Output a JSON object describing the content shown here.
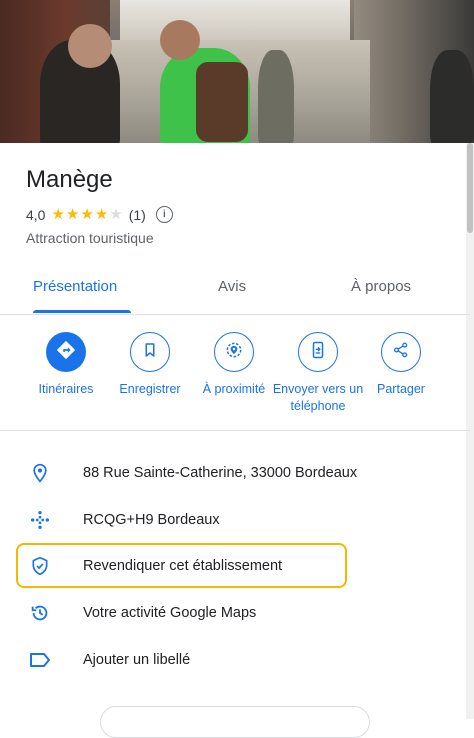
{
  "place": {
    "name": "Manège",
    "rating": "4,0",
    "stars_filled": 4,
    "stars_total": 5,
    "review_count": "(1)",
    "category": "Attraction touristique"
  },
  "tabs": [
    {
      "label": "Présentation",
      "active": true
    },
    {
      "label": "Avis",
      "active": false
    },
    {
      "label": "À propos",
      "active": false
    }
  ],
  "actions": [
    {
      "label": "Itinéraires",
      "icon": "directions-icon"
    },
    {
      "label": "Enregistrer",
      "icon": "bookmark-icon"
    },
    {
      "label": "À proximité",
      "icon": "nearby-icon"
    },
    {
      "label": "Envoyer vers un téléphone",
      "icon": "send-to-phone-icon"
    },
    {
      "label": "Partager",
      "icon": "share-icon"
    }
  ],
  "details": [
    {
      "text": "88 Rue Sainte-Catherine, 33000 Bordeaux",
      "icon": "location-pin-icon"
    },
    {
      "text": "RCQG+H9 Bordeaux",
      "icon": "plus-code-icon"
    },
    {
      "text": "Revendiquer cet établissement",
      "icon": "shield-check-icon"
    },
    {
      "text": "Votre activité Google Maps",
      "icon": "history-icon"
    },
    {
      "text": "Ajouter un libellé",
      "icon": "label-icon"
    }
  ],
  "colors": {
    "accent": "#1a73e8",
    "star": "#fbbc04",
    "highlight": "#f5b800"
  }
}
